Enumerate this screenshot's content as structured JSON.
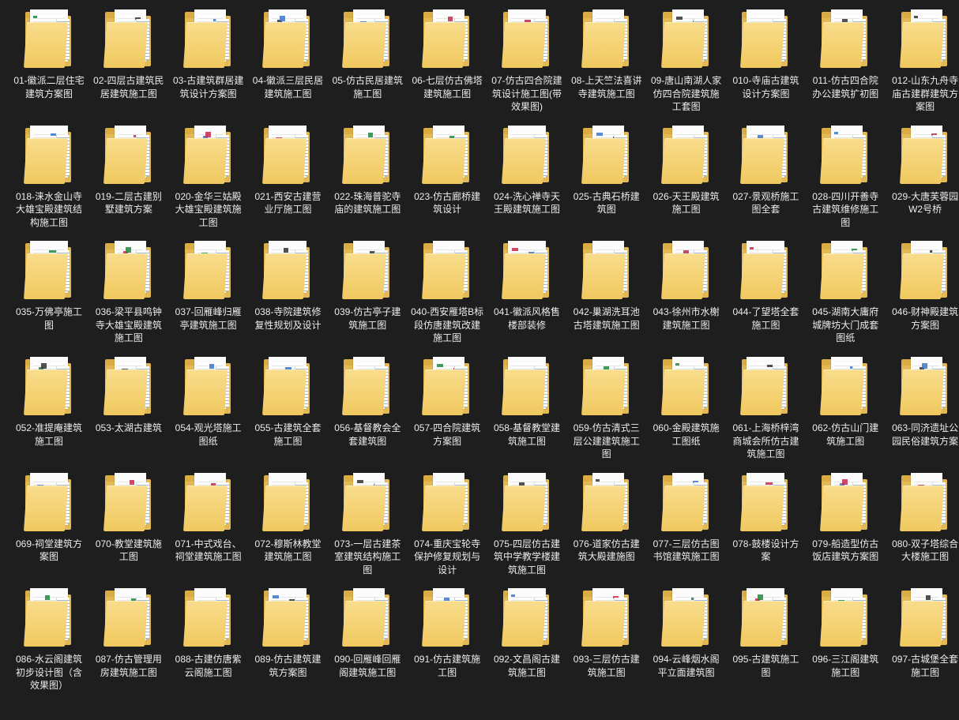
{
  "folders": [
    "01-徽派二层住宅建筑方案图",
    "02-四层古建筑民居建筑施工图",
    "03-古建筑群居建筑设计方案图",
    "04-徽派三层民居建筑施工图",
    "05-仿古民居建筑施工图",
    "06-七层仿古佛塔建筑施工图",
    "07-仿古四合院建筑设计施工图(带效果图)",
    "08-上天竺法喜讲寺建筑施工图",
    "09-唐山南湖人家仿四合院建筑施工套图",
    "010-寺庙古建筑设计方案图",
    "011-仿古四合院办公建筑扩初图",
    "012-山东九舟寺庙古建群建筑方案图",
    "018-涞水金山寺大雄宝殿建筑结构施工图",
    "019-二层古建别墅建筑方案",
    "020-金华三姑殿大雄宝殿建筑施工图",
    "021-西安古建营业厅施工图",
    "022-珠海普驼寺庙的建筑施工图",
    "023-仿古廊桥建筑设计",
    "024-洗心禅寺天王殿建筑施工图",
    "025-古典石桥建筑图",
    "026-天王殿建筑施工图",
    "027-景观桥施工图全套",
    "028-四川开善寺古建筑维修施工图",
    "029-大唐芙蓉园W2号桥",
    "035-万佛亭施工图",
    "036-梁平县鸣钟寺大雄宝殿建筑施工图",
    "037-回雁峰归雁亭建筑施工图",
    "038-寺院建筑修复性规划及设计",
    "039-仿古亭子建筑施工图",
    "040-西安雁塔B标段仿唐建筑改建施工图",
    "041-徽派风格售楼部装修",
    "042-巢湖洗耳池古塔建筑施工图",
    "043-徐州市水榭建筑施工图",
    "044-了望塔全套施工图",
    "045-湖南大庸府城牌坊大门成套图纸",
    "046-财神殿建筑方案图",
    "052-准提庵建筑施工图",
    "053-太湖古建筑",
    "054-观光塔施工图纸",
    "055-古建筑全套施工图",
    "056-基督教会全套建筑图",
    "057-四合院建筑方案图",
    "058-基督教堂建筑施工图",
    "059-仿古清式三层公建建筑施工图",
    "060-金殿建筑施工图纸",
    "061-上海桥梓湾商城会所仿古建筑施工图",
    "062-仿古山门建筑施工图",
    "063-同济遗址公园民俗建筑方案",
    "069-祠堂建筑方案图",
    "070-教堂建筑施工图",
    "071-中式戏台、祠堂建筑施工图",
    "072-穆斯林教堂建筑施工图",
    "073-一层古建茶室建筑结构施工图",
    "074-重庆宝轮寺保护修复规划与设计",
    "075-四层仿古建筑中学教学楼建筑施工图",
    "076-道家仿古建筑大殿建施图",
    "077-三层仿古图书馆建筑施工图",
    "078-鼓楼设计方案",
    "079-船造型仿古饭店建筑方案图",
    "080-双子塔综合大楼施工图",
    "086-水云阁建筑初步设计图（含效果图）",
    "087-仿古管理用房建筑施工图",
    "088-古建仿唐紫云阁施工图",
    "089-仿古建筑建筑方案图",
    "090-回雁峰回雁阁建筑施工图",
    "091-仿古建筑施工图",
    "092-文昌阁古建筑施工图",
    "093-三层仿古建筑施工图",
    "094-云峰烟水阁平立面建筑图",
    "095-古建筑施工图",
    "096-三江阁建筑施工图",
    "097-古城堡全套施工图"
  ],
  "colors": {
    "background": "#1e1e1e",
    "label": "#ececec",
    "folder": "#f0c85f"
  },
  "icons": [
    "folder-icon"
  ]
}
